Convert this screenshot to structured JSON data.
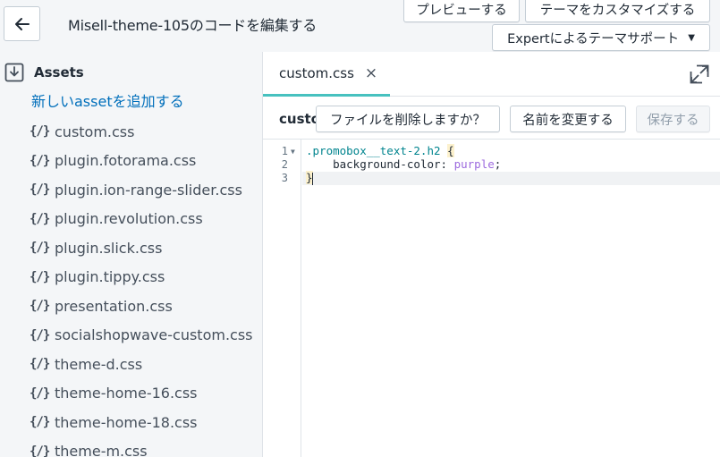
{
  "header": {
    "title": "Misell-theme-105のコードを編集する",
    "back_icon": "arrow-left-icon",
    "buttons": {
      "preview": "プレビューする",
      "customize": "テーマをカスタマイズする",
      "support": "Expertによるテーマサポート"
    }
  },
  "sidebar": {
    "folder_title": "Assets",
    "add_asset_label": "新しいassetを追加する",
    "file_icon_text": "{/}",
    "files": [
      "custom.css",
      "plugin.fotorama.css",
      "plugin.ion-range-slider.css",
      "plugin.revolution.css",
      "plugin.slick.css",
      "plugin.tippy.css",
      "presentation.css",
      "socialshopwave-custom.css",
      "theme-d.css",
      "theme-home-16.css",
      "theme-home-18.css",
      "theme-m.css"
    ]
  },
  "editor": {
    "tab_label": "custom.css",
    "tab_close": "×",
    "file_title": "custom.css",
    "buttons": {
      "delete": "ファイルを削除しますか？",
      "rename": "名前を変更する",
      "save": "保存する"
    },
    "line_numbers": [
      "1",
      "2",
      "3"
    ],
    "code": {
      "line1_selector": ".promobox__text-2.h2",
      "line1_brace": "{",
      "line2_property": "background-color",
      "line2_colon": ": ",
      "line2_value": "purple",
      "line2_semicolon": ";",
      "line3_brace": "}"
    }
  },
  "colors": {
    "accent_tab": "#47c1bf",
    "link": "#006fbb",
    "selector": "#00848e",
    "value": "#9c6ade"
  }
}
